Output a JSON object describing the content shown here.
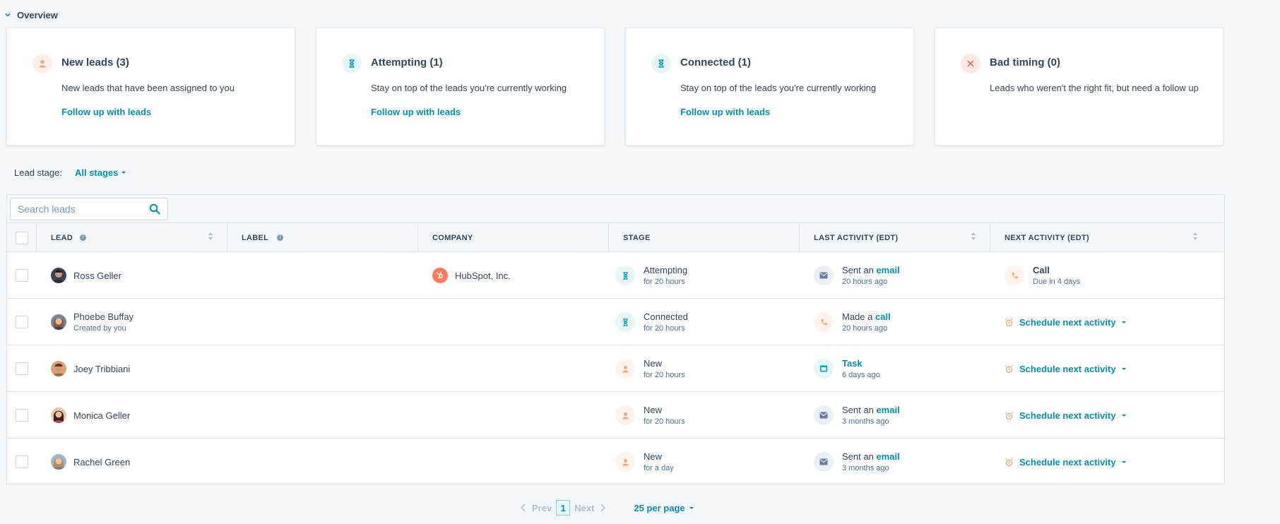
{
  "overview": {
    "title": "Overview"
  },
  "cards": [
    {
      "title": "New leads (3)",
      "desc": "New leads that have been assigned to you",
      "link": "Follow up with leads",
      "icon": "person-icon"
    },
    {
      "title": "Attempting (1)",
      "desc": "Stay on top of the leads you're currently working",
      "link": "Follow up with leads",
      "icon": "hourglass-icon"
    },
    {
      "title": "Connected (1)",
      "desc": "Stay on top of the leads you're currently working",
      "link": "Follow up with leads",
      "icon": "hourglass-icon"
    },
    {
      "title": "Bad timing (0)",
      "desc": "Leads who weren't the right fit, but need a follow up",
      "link": "",
      "icon": "x-icon"
    }
  ],
  "filter": {
    "label": "Lead stage:",
    "value": "All stages"
  },
  "search": {
    "placeholder": "Search leads"
  },
  "columns": {
    "lead": "LEAD",
    "label": "LABEL",
    "company": "COMPANY",
    "stage": "STAGE",
    "last_activity": "LAST ACTIVITY (EDT)",
    "next_activity": "NEXT ACTIVITY (EDT)"
  },
  "rows": [
    {
      "name": "Ross Geller",
      "sub": "",
      "company": "HubSpot, Inc.",
      "stage": "Attempting",
      "stage_time": "for 20 hours",
      "last_prefix": "Sent an ",
      "last_link": "email",
      "last_time": "20 hours ago",
      "next_title": "Call",
      "next_sub": "Due in 4 days"
    },
    {
      "name": "Phoebe Buffay",
      "sub": "Created by you",
      "company": "",
      "stage": "Connected",
      "stage_time": "for 20 hours",
      "last_prefix": "Made a ",
      "last_link": "call",
      "last_time": "20 hours ago",
      "next_title": "Schedule next activity",
      "next_sub": ""
    },
    {
      "name": "Joey Tribbiani",
      "sub": "",
      "company": "",
      "stage": "New",
      "stage_time": "for 20 hours",
      "last_prefix": "",
      "last_link": "Task",
      "last_time": "6 days ago",
      "next_title": "Schedule next activity",
      "next_sub": ""
    },
    {
      "name": "Monica Geller",
      "sub": "",
      "company": "",
      "stage": "New",
      "stage_time": "for 20 hours",
      "last_prefix": "Sent an ",
      "last_link": "email",
      "last_time": "3 months ago",
      "next_title": "Schedule next activity",
      "next_sub": ""
    },
    {
      "name": "Rachel Green",
      "sub": "",
      "company": "",
      "stage": "New",
      "stage_time": "for a day",
      "last_prefix": "Sent an ",
      "last_link": "email",
      "last_time": "3 months ago",
      "next_title": "Schedule next activity",
      "next_sub": ""
    }
  ],
  "pagination": {
    "prev": "Prev",
    "page": "1",
    "next": "Next",
    "per_page": "25 per page"
  },
  "colors": {
    "accent": "#0091ae",
    "text": "#33475b",
    "orange": "#ff7a59",
    "teal": "#00a4bd"
  }
}
